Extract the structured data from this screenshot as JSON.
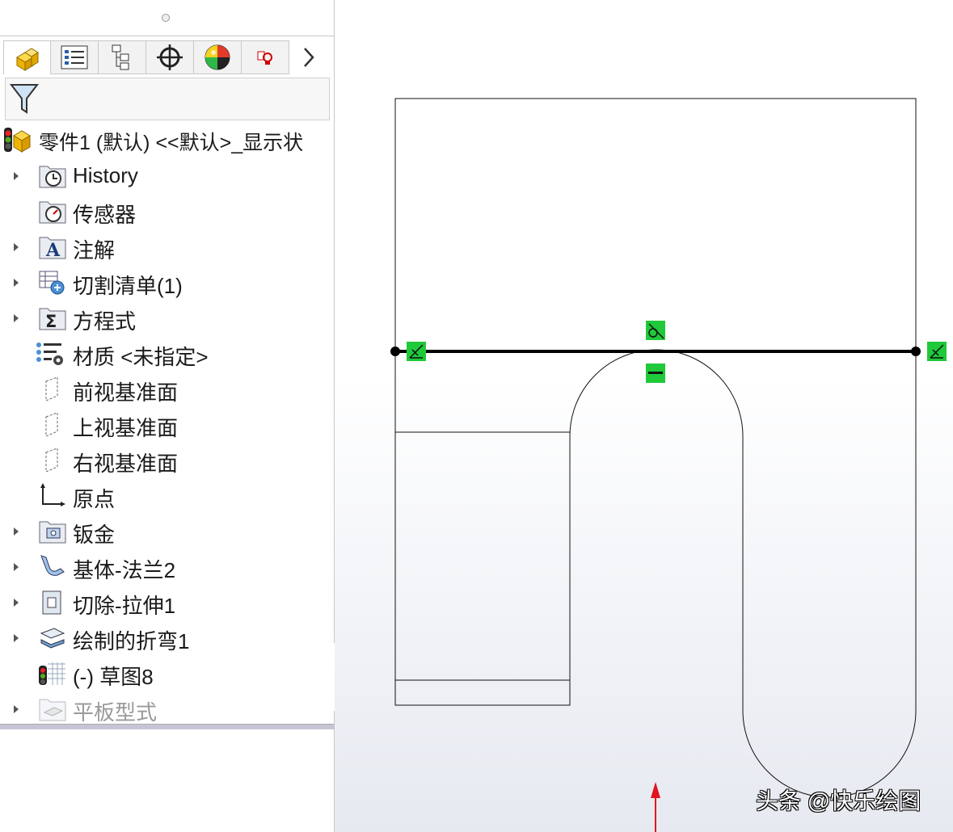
{
  "feature_tree": {
    "root": {
      "label": "零件1 (默认) <<默认>_显示状"
    },
    "items": [
      {
        "label": "History",
        "icon": "history-icon",
        "expandable": true
      },
      {
        "label": "传感器",
        "icon": "sensors-icon",
        "expandable": false
      },
      {
        "label": "注解",
        "icon": "annotations-icon",
        "expandable": true
      },
      {
        "label": "切割清单(1)",
        "icon": "cut-list-icon",
        "expandable": true
      },
      {
        "label": "方程式",
        "icon": "equations-icon",
        "expandable": true
      },
      {
        "label": "材质 <未指定>",
        "icon": "material-icon",
        "expandable": false
      },
      {
        "label": "前视基准面",
        "icon": "plane-icon",
        "expandable": false
      },
      {
        "label": "上视基准面",
        "icon": "plane-icon",
        "expandable": false
      },
      {
        "label": "右视基准面",
        "icon": "plane-icon",
        "expandable": false
      },
      {
        "label": "原点",
        "icon": "origin-icon",
        "expandable": false
      },
      {
        "label": "钣金",
        "icon": "sheet-metal-icon",
        "expandable": true
      },
      {
        "label": "基体-法兰2",
        "icon": "base-flange-icon",
        "expandable": true
      },
      {
        "label": "切除-拉伸1",
        "icon": "cut-extrude-icon",
        "expandable": true
      },
      {
        "label": "绘制的折弯1",
        "icon": "sketched-bend-icon",
        "expandable": true
      },
      {
        "label": "(-) 草图8",
        "icon": "sketch-icon",
        "expandable": false
      },
      {
        "label": "平板型式",
        "icon": "flat-pattern-icon",
        "expandable": true,
        "suppressed": true
      }
    ]
  },
  "tabs": [
    {
      "name": "featuremanager",
      "icon": "part-icon"
    },
    {
      "name": "propertymanager",
      "icon": "property-list-icon"
    },
    {
      "name": "configurationmanager",
      "icon": "configuration-icon"
    },
    {
      "name": "dimxpertmanager",
      "icon": "crosshair-icon"
    },
    {
      "name": "displaymanager",
      "icon": "appearance-ball-icon"
    },
    {
      "name": "cam",
      "icon": "cam-icon"
    }
  ],
  "colors": {
    "relation_green": "#1fc93a",
    "axis_red": "#e0131f",
    "bend_line": "#000000"
  },
  "watermark": "头条 @快乐绘图"
}
